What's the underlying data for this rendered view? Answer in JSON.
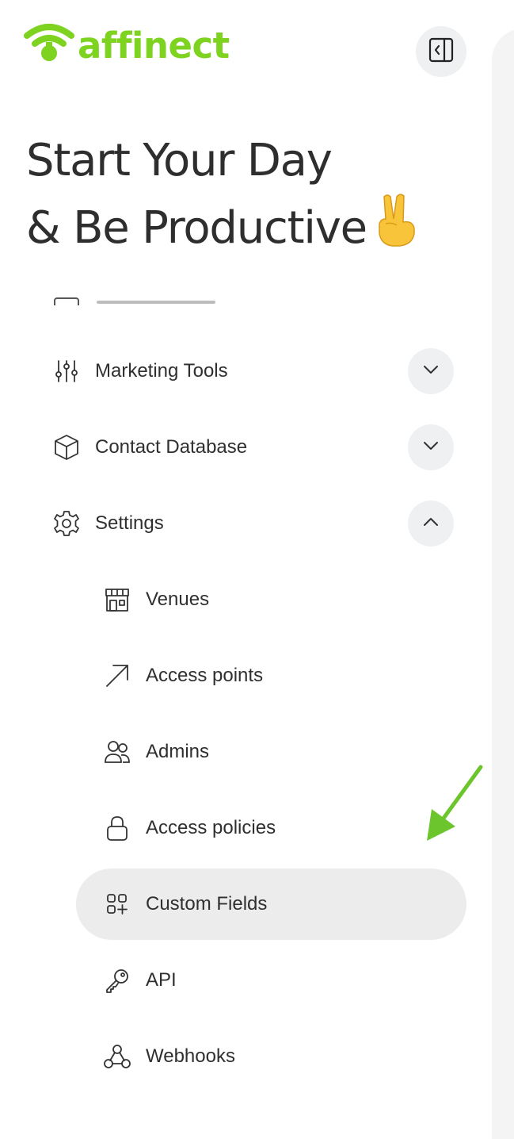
{
  "brand": {
    "name": "affinect",
    "logo_icon": "wifi-pin-icon",
    "accent": "#7ed321"
  },
  "header": {
    "collapse_icon": "sidebar-collapse-icon"
  },
  "headline": {
    "line1": "Start Your Day",
    "line2": "& Be Productive",
    "emoji": "✌️"
  },
  "nav": {
    "items": [
      {
        "label": "Marketing Tools",
        "icon": "sliders-icon",
        "expanded": false
      },
      {
        "label": "Contact Database",
        "icon": "cube-icon",
        "expanded": false
      },
      {
        "label": "Settings",
        "icon": "gear-icon",
        "expanded": true
      }
    ],
    "settings_children": [
      {
        "label": "Venues",
        "icon": "storefront-icon"
      },
      {
        "label": "Access points",
        "icon": "arrow-up-right-icon"
      },
      {
        "label": "Admins",
        "icon": "users-icon"
      },
      {
        "label": "Access policies",
        "icon": "lock-icon"
      },
      {
        "label": "Custom Fields",
        "icon": "grid-plus-icon",
        "active": true
      },
      {
        "label": "API",
        "icon": "key-icon"
      },
      {
        "label": "Webhooks",
        "icon": "webhook-icon"
      }
    ]
  },
  "annotation": {
    "arrow_color": "#6cc52d"
  }
}
